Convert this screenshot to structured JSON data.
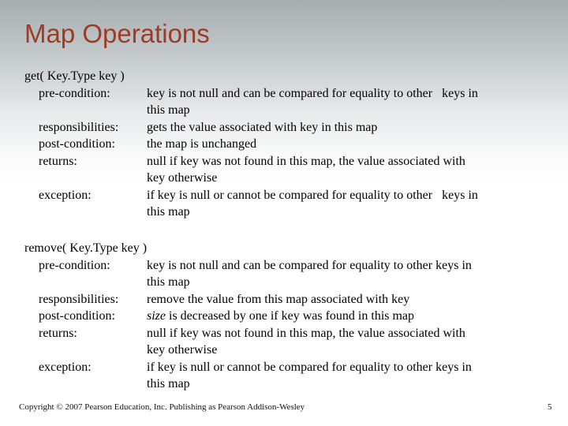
{
  "slide": {
    "title": "Map Operations",
    "title_color": "#9c3b26",
    "footer": "Copyright © 2007 Pearson Education, Inc. Publishing as Pearson Addison-Wesley",
    "page_number": "5"
  },
  "operations": [
    {
      "signature": "get( Key.Type key )",
      "rows": [
        {
          "label": "pre-condition:",
          "lines": [
            "key is not null and can be compared for equality to other   keys in",
            "this map"
          ]
        },
        {
          "label": "responsibilities:",
          "lines": [
            "gets the value associated with key in this map"
          ]
        },
        {
          "label": "post-condition:",
          "lines": [
            "the map is unchanged"
          ]
        },
        {
          "label": "returns:",
          "lines": [
            "null if key was not found in this map, the value associated with",
            "key otherwise"
          ]
        },
        {
          "label": "exception:",
          "lines": [
            "if key is null or cannot be compared for equality to other   keys in",
            "this map"
          ]
        }
      ]
    },
    {
      "signature": "remove( Key.Type key )",
      "rows": [
        {
          "label": "pre-condition:",
          "lines": [
            "key is not null and can be compared for equality to other keys in",
            "this map"
          ]
        },
        {
          "label": "responsibilities:",
          "lines": [
            "remove the value from this map associated with key"
          ]
        },
        {
          "label": "post-condition:",
          "italic_prefix": "size",
          "lines": [
            " is decreased by one if key was found in this map"
          ]
        },
        {
          "label": "returns:",
          "lines": [
            "null if key was not found in this map, the value associated with",
            "key otherwise"
          ]
        },
        {
          "label": "exception:",
          "lines": [
            "if key is null or cannot be compared for equality to other keys in",
            "this map"
          ]
        }
      ]
    }
  ]
}
